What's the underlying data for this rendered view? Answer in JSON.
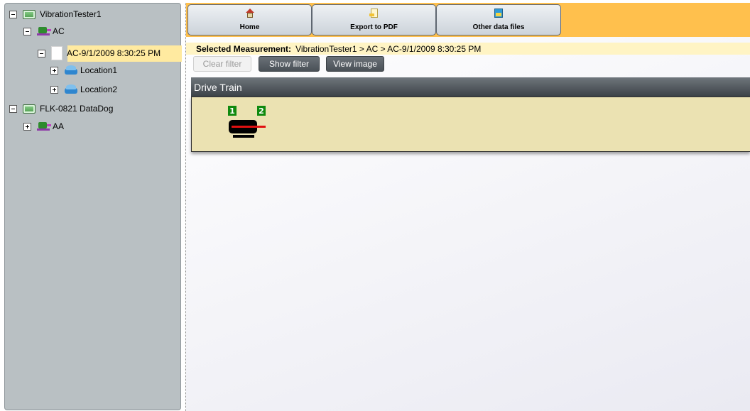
{
  "tree": {
    "nodes": [
      {
        "label": "VibrationTester1",
        "expander": "minus",
        "icon": "device-icon"
      },
      {
        "label": "AC",
        "expander": "minus",
        "icon": "machine-icon"
      },
      {
        "label": "AC-9/1/2009 8:30:25 PM",
        "expander": "minus",
        "icon": "measurement-icon",
        "selected": true
      },
      {
        "label": "Location1",
        "expander": "plus",
        "icon": "location-icon"
      },
      {
        "label": "Location2",
        "expander": "plus",
        "icon": "location-icon"
      },
      {
        "label": "FLK-0821 DataDog",
        "expander": "minus",
        "icon": "device-icon"
      },
      {
        "label": "AA",
        "expander": "plus",
        "icon": "machine-icon"
      }
    ]
  },
  "toolbar": {
    "home_label": "Home",
    "export_label": "Export to PDF",
    "other_files_label": "Other data files"
  },
  "breadcrumb": {
    "label": "Selected Measurement:",
    "path": "VibrationTester1 > AC > AC-9/1/2009 8:30:25 PM"
  },
  "actions": {
    "clear_filter": "Clear filter",
    "show_filter": "Show filter",
    "view_image": "View image"
  },
  "drive_train": {
    "title": "Drive Train",
    "points": [
      "1",
      "2"
    ]
  },
  "colors": {
    "toolbar_bg": "#ffc04d",
    "tree_bg": "#b9c0c3",
    "selected_bg": "#ffeaa0",
    "breadcrumb_bg": "#fff4c4",
    "panel_bg": "#ebe2b2",
    "point_marker": "#0f8a0f"
  }
}
